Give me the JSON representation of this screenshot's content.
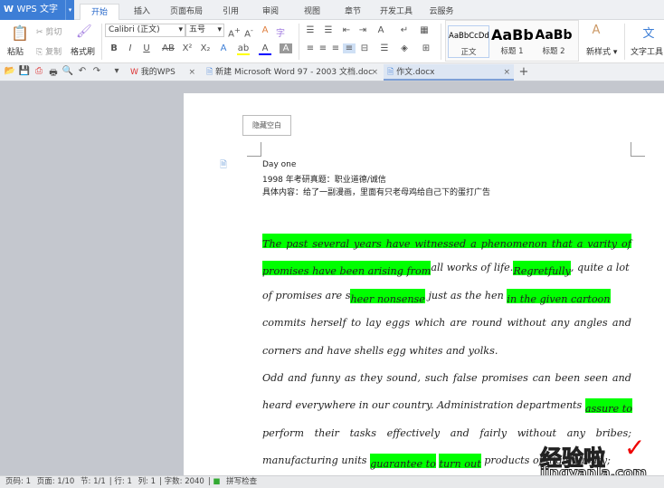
{
  "app": {
    "title": "WPS 文字"
  },
  "menu_tabs": [
    "开始",
    "插入",
    "页面布局",
    "引用",
    "审阅",
    "视图",
    "章节",
    "开发工具",
    "云服务"
  ],
  "active_tab": "开始",
  "ribbon": {
    "paste": "粘贴",
    "cut": "剪切",
    "copy": "复制",
    "format_painter": "格式刷",
    "font_name": "Calibri (正文)",
    "font_size": "五号",
    "styles": [
      {
        "preview": "AaBbCcDd",
        "name": "正文"
      },
      {
        "preview": "AaBb",
        "name": "标题 1"
      },
      {
        "preview": "AaBb",
        "name": "标题 2"
      }
    ],
    "new_style": "新样式",
    "text_tools": "文字工具"
  },
  "doc_tabs": [
    {
      "label": "我的WPS"
    },
    {
      "label": "新建 Microsoft Word 97 - 2003 文档.doc"
    },
    {
      "label": "作文.docx",
      "active": true
    }
  ],
  "hide_blank": "隐藏空白",
  "header_lines": [
    "Day one",
    "1998 年考研真题：职业道德/诚信",
    "具体内容：给了一副漫画，里面有只老母鸡给自己下的蛋打广告"
  ],
  "highlight_color": "#00ff00",
  "body_lines": [
    [
      {
        "t": "The past several years have witnessed a phenomenon that a varity of",
        "hl": true
      }
    ],
    [
      {
        "t": "promises have been arising from",
        "hl": true
      },
      {
        "t": "all works of life."
      },
      {
        "t": "Regretfully",
        "hl": true
      },
      {
        "t": ", quite a lot"
      }
    ],
    [
      {
        "t": "of promises are s"
      },
      {
        "t": "heer nonsense",
        "hl": true
      },
      {
        "t": " just as the hen "
      },
      {
        "t": "in the given cartoon",
        "hl": true
      }
    ],
    [
      {
        "t": "commits herself to lay eggs which are round without any angles and"
      }
    ],
    [
      {
        "t": "corners and have shells egg whites and yolks."
      }
    ],
    [
      {
        "t": "Odd and funny as they sound, such false promises can been seen and"
      }
    ],
    [
      {
        "t": "heard everywhere in our country. Administration departments "
      },
      {
        "t": "assure to",
        "hl": true
      }
    ],
    [
      {
        "t": "perform their tasks effectively and fairly without any bribes;"
      }
    ],
    [
      {
        "t": "manufacturing units "
      },
      {
        "t": "guarantee to",
        "hl": true
      },
      {
        "t": " "
      },
      {
        "t": "turn out",
        "hl": true
      },
      {
        "t": " products of high quality;"
      }
    ]
  ],
  "status": {
    "page": "页码: 1",
    "pages": "页面: 1/10",
    "section": "节: 1/1",
    "row": "行: 1",
    "col": "列: 1",
    "words": "字数: 2040",
    "spell": "拼写检查"
  },
  "watermark": {
    "text": "经验啦",
    "url_text": "jingyanla.com"
  }
}
